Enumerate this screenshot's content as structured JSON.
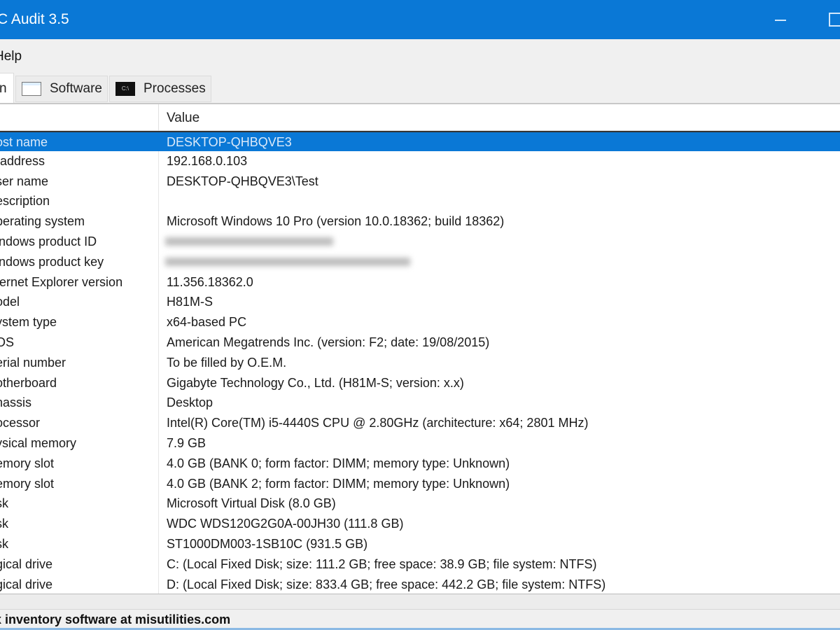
{
  "window": {
    "title": "C Audit 3.5"
  },
  "menu": [
    "Help"
  ],
  "tabs": [
    {
      "label": "n"
    },
    {
      "label": "Software"
    },
    {
      "label": "Processes"
    }
  ],
  "list": {
    "value_header": "Value",
    "rows": [
      {
        "name": "ost name",
        "value": "DESKTOP-QHBQVE3"
      },
      {
        "name": "-address",
        "value": "192.168.0.103"
      },
      {
        "name": "ser name",
        "value": "DESKTOP-QHBQVE3\\Test"
      },
      {
        "name": "escription",
        "value": ""
      },
      {
        "name": "perating system",
        "value": "Microsoft Windows 10 Pro (version 10.0.18362; build 18362)"
      },
      {
        "name": "indows product ID",
        "value": ""
      },
      {
        "name": "indows product key",
        "value": ""
      },
      {
        "name": "ternet Explorer version",
        "value": "11.356.18362.0"
      },
      {
        "name": "odel",
        "value": "H81M-S"
      },
      {
        "name": "ystem type",
        "value": "x64-based PC"
      },
      {
        "name": "OS",
        "value": "American Megatrends Inc. (version: F2; date: 19/08/2015)"
      },
      {
        "name": "erial number",
        "value": "To be filled by O.E.M."
      },
      {
        "name": "otherboard",
        "value": "Gigabyte Technology Co., Ltd. (H81M-S; version: x.x)"
      },
      {
        "name": "hassis",
        "value": "Desktop"
      },
      {
        "name": "ocessor",
        "value": "Intel(R) Core(TM) i5-4440S CPU @ 2.80GHz (architecture: x64; 2801 MHz)"
      },
      {
        "name": "ysical memory",
        "value": "7.9 GB"
      },
      {
        "name": "emory slot",
        "value": "4.0 GB (BANK 0; form factor: DIMM; memory type: Unknown)"
      },
      {
        "name": "emory slot",
        "value": "4.0 GB (BANK 2; form factor: DIMM; memory type: Unknown)"
      },
      {
        "name": "sk",
        "value": "Microsoft Virtual Disk (8.0 GB)"
      },
      {
        "name": "sk",
        "value": "WDC WDS120G2G0A-00JH30 (111.8 GB)"
      },
      {
        "name": "sk",
        "value": "ST1000DM003-1SB10C (931.5 GB)"
      },
      {
        "name": "gical drive",
        "value": "C: (Local Fixed Disk; size: 111.2 GB; free space: 38.9 GB; file system: NTFS)"
      },
      {
        "name": "gical drive",
        "value": "D: (Local Fixed Disk; size: 833.4 GB; free space: 442.2 GB; file system: NTFS)"
      }
    ]
  },
  "status": "x inventory software at misutilities.com"
}
